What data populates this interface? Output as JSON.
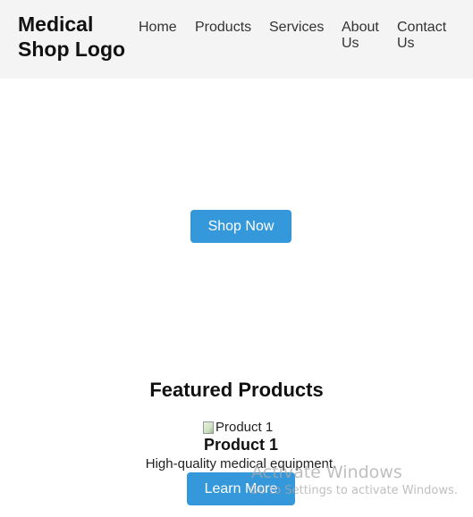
{
  "header": {
    "logo": "Medical\nShop Logo",
    "nav": {
      "home": "Home",
      "products": "Products",
      "services": "Services",
      "about": "About\nUs",
      "contact": "Contact\nUs"
    }
  },
  "hero": {
    "cta_label": "Shop Now"
  },
  "featured": {
    "title": "Featured Products",
    "products": [
      {
        "image_alt": "Product 1",
        "name": "Product 1",
        "description": "High-quality medical equipment.",
        "button_label": "Learn More"
      }
    ]
  },
  "watermark": {
    "title": "Activate Windows",
    "subtitle": "Go to Settings to activate Windows."
  },
  "colors": {
    "header_bg": "#f4f4f4",
    "accent": "#3498db"
  }
}
